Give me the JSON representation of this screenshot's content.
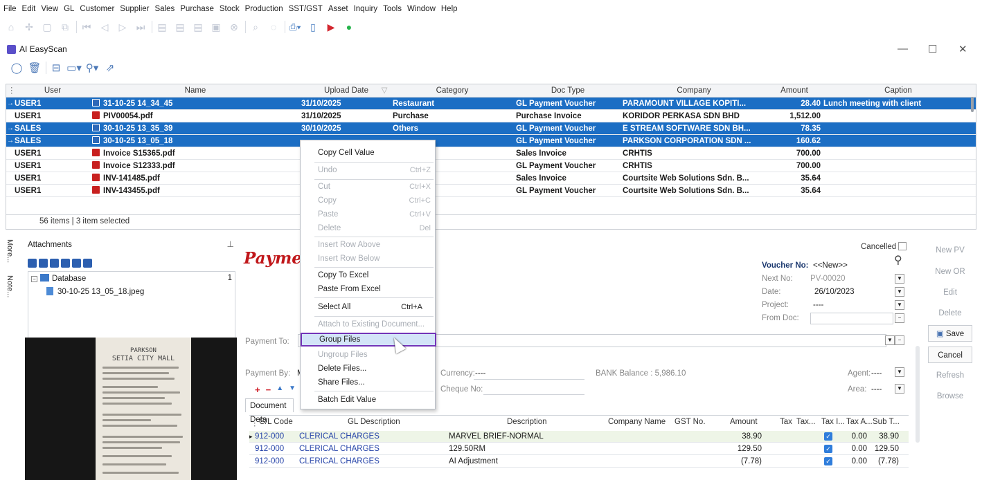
{
  "menubar": [
    "File",
    "Edit",
    "View",
    "GL",
    "Customer",
    "Supplier",
    "Sales",
    "Purchase",
    "Stock",
    "Production",
    "SST/GST",
    "Asset",
    "Inquiry",
    "Tools",
    "Window",
    "Help"
  ],
  "window": {
    "title": "AI EasyScan",
    "minimize": "—",
    "maximize": "☐",
    "close": "✕"
  },
  "grid": {
    "columns": [
      "User",
      "Name",
      "Upload Date",
      "Category",
      "Doc Type",
      "Company",
      "Amount",
      "Caption"
    ],
    "rows": [
      {
        "user": "USER1",
        "name": "31-10-25 14_34_45",
        "date": "31/10/2025",
        "category": "Restaurant",
        "doctype": "GL Payment Voucher",
        "company": "PARAMOUNT VILLAGE KOPITI...",
        "amount": "28.40",
        "caption": "Lunch meeting with client",
        "selected": true,
        "icon": "image-file-icon"
      },
      {
        "user": "USER1",
        "name": "PIV00054.pdf",
        "date": "31/10/2025",
        "category": "Purchase",
        "doctype": "Purchase Invoice",
        "company": "KORIDOR PERKASA SDN BHD",
        "amount": "1,512.00",
        "caption": "",
        "selected": false,
        "icon": "pdf-file-icon"
      },
      {
        "user": "SALES",
        "name": "30-10-25 13_35_39",
        "date": "30/10/2025",
        "category": "Others",
        "doctype": "GL Payment Voucher",
        "company": "E STREAM SOFTWARE SDN BH...",
        "amount": "78.35",
        "caption": "",
        "selected": true,
        "icon": "image-file-icon"
      },
      {
        "user": "SALES",
        "name": "30-10-25 13_05_18",
        "date": "",
        "category": "",
        "doctype": "GL Payment Voucher",
        "company": "PARKSON CORPORATION SDN ...",
        "amount": "160.62",
        "caption": "",
        "selected": true,
        "icon": "image-file-icon"
      },
      {
        "user": "USER1",
        "name": "Invoice S15365.pdf",
        "date": "",
        "category": "",
        "doctype": "Sales Invoice",
        "company": "CRHTIS",
        "amount": "700.00",
        "caption": "",
        "selected": false,
        "icon": "pdf-file-icon"
      },
      {
        "user": "USER1",
        "name": "Invoice S12333.pdf",
        "date": "",
        "category": "",
        "doctype": "GL Payment Voucher",
        "company": "CRHTIS",
        "amount": "700.00",
        "caption": "",
        "selected": false,
        "icon": "pdf-file-icon"
      },
      {
        "user": "USER1",
        "name": "INV-141485.pdf",
        "date": "",
        "category": "",
        "doctype": "Sales Invoice",
        "company": "Courtsite Web Solutions Sdn. B...",
        "amount": "35.64",
        "caption": "",
        "selected": false,
        "icon": "pdf-file-icon"
      },
      {
        "user": "USER1",
        "name": "INV-143455.pdf",
        "date": "",
        "category": "",
        "doctype": "GL Payment Voucher",
        "company": "Courtsite Web Solutions Sdn. B...",
        "amount": "35.64",
        "caption": "",
        "selected": false,
        "icon": "pdf-file-icon"
      }
    ],
    "footer": "56 items | 3 item selected"
  },
  "sidetabs": {
    "more": "More...",
    "note": "Note..."
  },
  "attachments": {
    "title": "Attachments",
    "tree_root": "Database",
    "tree_root_count": "1",
    "tree_child": "30-10-25 13_05_18.jpeg",
    "receipt_header": [
      "PARKSON",
      "SETIA CITY MALL"
    ]
  },
  "form": {
    "title": "Payme",
    "cancelled_label": "Cancelled",
    "voucher_no_label": "Voucher No:",
    "voucher_no_value": "<<New>>",
    "next_no_label": "Next No:",
    "next_no_value": "PV-00020",
    "date_label": "Date:",
    "date_value": "26/10/2023",
    "project_label": "Project:",
    "project_value": "----",
    "from_doc_label": "From Doc:",
    "payment_to_label": "Payment To:",
    "payment_by_label": "Payment By:",
    "payment_by_value": "M",
    "currency_label": "Currency:",
    "currency_value": "----",
    "bank_balance": "BANK Balance : 5,986.10",
    "cheque_label": "Cheque No:",
    "agent_label": "Agent:",
    "agent_value": "----",
    "area_label": "Area:",
    "area_value": "----",
    "doc_tab": "Document Deta"
  },
  "side_buttons": {
    "new_pv": "New PV",
    "new_or": "New OR",
    "edit": "Edit",
    "delete": "Delete",
    "save": "Save",
    "cancel": "Cancel",
    "refresh": "Refresh",
    "browse": "Browse"
  },
  "detail": {
    "columns": [
      "G/L Code",
      "GL Description",
      "Description",
      "Company Name",
      "GST No.",
      "Amount",
      "Tax",
      "Tax...",
      "Tax I...",
      "Tax A...",
      "Sub T..."
    ],
    "rows": [
      {
        "code": "912-000",
        "gl": "CLERICAL CHARGES",
        "desc": "MARVEL BRIEF-NORMAL",
        "amount": "38.90",
        "taxamt": "0.00",
        "sub": "38.90"
      },
      {
        "code": "912-000",
        "gl": "CLERICAL CHARGES",
        "desc": "129.50RM",
        "amount": "129.50",
        "taxamt": "0.00",
        "sub": "129.50"
      },
      {
        "code": "912-000",
        "gl": "CLERICAL CHARGES",
        "desc": "AI Adjustment",
        "amount": "(7.78)",
        "taxamt": "0.00",
        "sub": "(7.78)"
      }
    ]
  },
  "context_menu": [
    {
      "label": "Copy Cell Value",
      "shortcut": "",
      "disabled": false
    },
    {
      "label": "Undo",
      "shortcut": "Ctrl+Z",
      "disabled": true
    },
    {
      "label": "Cut",
      "shortcut": "Ctrl+X",
      "disabled": true
    },
    {
      "label": "Copy",
      "shortcut": "Ctrl+C",
      "disabled": true
    },
    {
      "label": "Paste",
      "shortcut": "Ctrl+V",
      "disabled": true
    },
    {
      "label": "Delete",
      "shortcut": "Del",
      "disabled": true
    },
    {
      "label": "Insert Row Above",
      "shortcut": "",
      "disabled": true
    },
    {
      "label": "Insert Row Below",
      "shortcut": "",
      "disabled": true
    },
    {
      "label": "Copy To Excel",
      "shortcut": "",
      "disabled": false
    },
    {
      "label": "Paste From Excel",
      "shortcut": "",
      "disabled": false
    },
    {
      "label": "Select All",
      "shortcut": "Ctrl+A",
      "disabled": false
    },
    {
      "label": "Attach to Existing Document...",
      "shortcut": "",
      "disabled": true
    },
    {
      "label": "Group Files",
      "shortcut": "",
      "disabled": false
    },
    {
      "label": "Ungroup Files",
      "shortcut": "",
      "disabled": true
    },
    {
      "label": "Delete Files...",
      "shortcut": "",
      "disabled": false
    },
    {
      "label": "Share Files...",
      "shortcut": "",
      "disabled": false
    },
    {
      "label": "Batch Edit Value",
      "shortcut": "",
      "disabled": false
    }
  ],
  "colors": {
    "selection": "#1c6ec4",
    "title_red": "#c0171a",
    "highlight_border": "#7334b8",
    "link_blue": "#2442a8"
  }
}
